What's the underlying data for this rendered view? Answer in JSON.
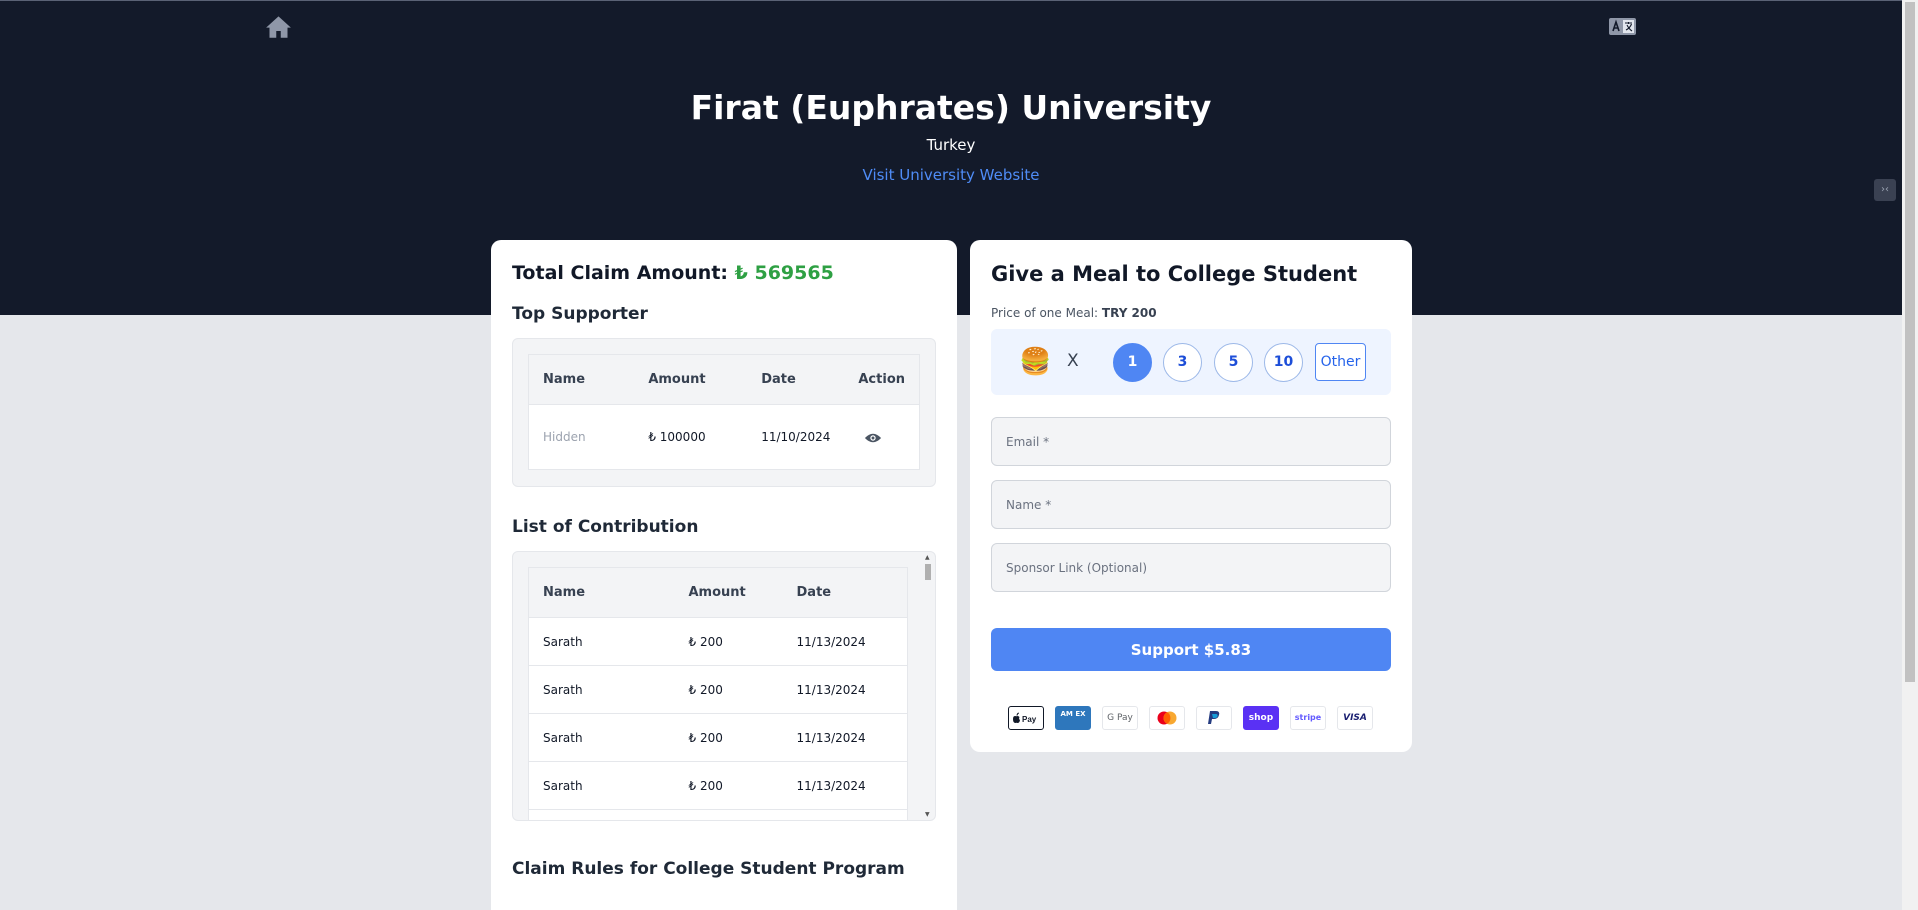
{
  "header": {
    "home_icon": "home-icon",
    "translate_icon": "translate-icon",
    "university_name": "Firat (Euphrates) University",
    "country": "Turkey",
    "website_link_label": "Visit University Website"
  },
  "claim": {
    "total_label": "Total Claim Amount:",
    "total_amount": "₺ 569565"
  },
  "top_supporter": {
    "heading": "Top Supporter",
    "columns": [
      "Name",
      "Amount",
      "Date",
      "Action"
    ],
    "rows": [
      {
        "name": "Hidden",
        "amount": "₺ 100000",
        "date": "11/10/2024",
        "action_icon": "eye-icon"
      }
    ]
  },
  "contributions": {
    "heading": "List of Contribution",
    "columns": [
      "Name",
      "Amount",
      "Date"
    ],
    "rows": [
      {
        "name": "Sarath",
        "amount": "₺ 200",
        "date": "11/13/2024"
      },
      {
        "name": "Sarath",
        "amount": "₺ 200",
        "date": "11/13/2024"
      },
      {
        "name": "Sarath",
        "amount": "₺ 200",
        "date": "11/13/2024"
      },
      {
        "name": "Sarath",
        "amount": "₺ 200",
        "date": "11/13/2024"
      }
    ]
  },
  "rules": {
    "heading": "Claim Rules for College Student Program"
  },
  "donation": {
    "title": "Give a Meal to College Student",
    "price_label": "Price of one Meal:",
    "price_value": "TRY 200",
    "meal_icon": "burger-icon",
    "times_symbol": "X",
    "quantities": [
      "1",
      "3",
      "5",
      "10"
    ],
    "selected_quantity": "1",
    "other_label": "Other",
    "email_placeholder": "Email *",
    "name_placeholder": "Name *",
    "sponsor_placeholder": "Sponsor Link (Optional)",
    "support_button": "Support $5.83",
    "payment_methods": [
      {
        "name": "apple-pay-icon"
      },
      {
        "name": "amex-icon",
        "label": "AM EX"
      },
      {
        "name": "google-pay-icon",
        "label": "G Pay"
      },
      {
        "name": "mastercard-icon"
      },
      {
        "name": "paypal-icon"
      },
      {
        "name": "shop-pay-icon",
        "label": "shop"
      },
      {
        "name": "stripe-icon",
        "label": "stripe"
      },
      {
        "name": "visa-icon",
        "label": "VISA"
      }
    ]
  },
  "colors": {
    "hero_bg": "#131a2a",
    "accent_blue": "#4f86f3",
    "amount_green": "#2ea043",
    "page_bg": "#e5e7eb"
  }
}
